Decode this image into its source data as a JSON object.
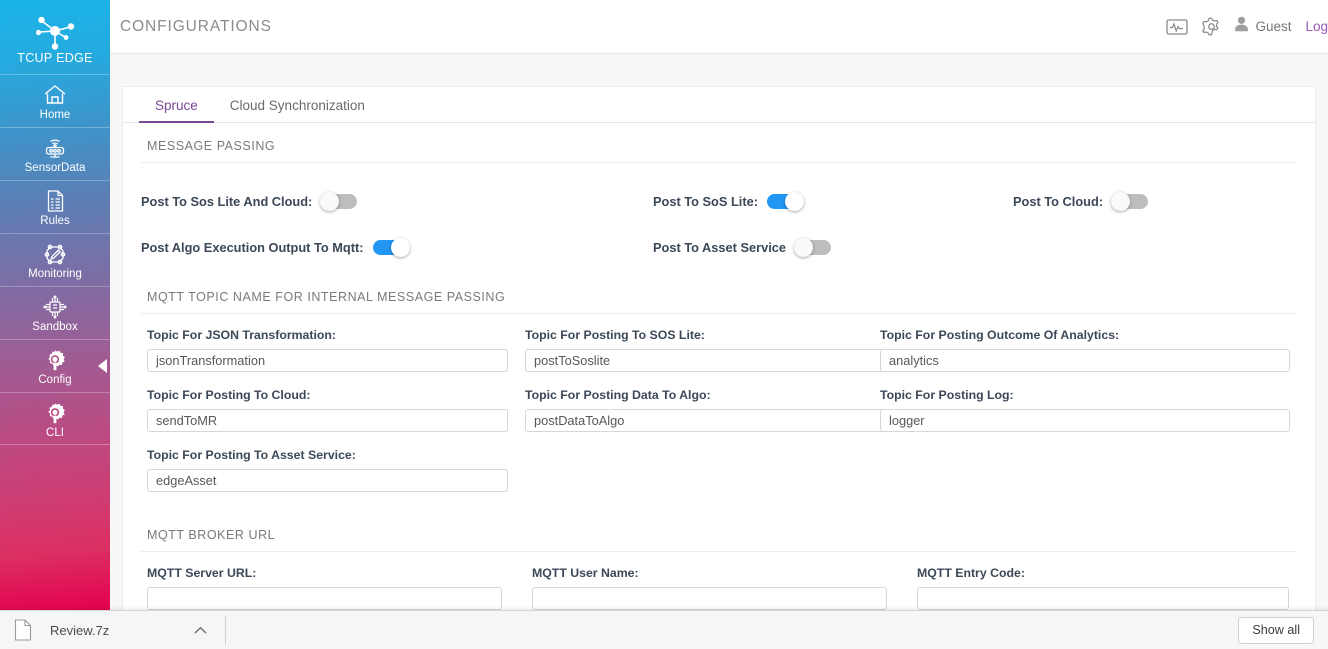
{
  "sidebar": {
    "logo": {
      "icon": "network-nodes-logo",
      "text": "TCUP EDGE"
    },
    "items": [
      {
        "label": "Home",
        "icon": "home-icon"
      },
      {
        "label": "SensorData",
        "icon": "sensor-icon"
      },
      {
        "label": "Rules",
        "icon": "document-rules-icon"
      },
      {
        "label": "Monitoring",
        "icon": "monitoring-icon"
      },
      {
        "label": "Sandbox",
        "icon": "chip-sandbox-icon"
      },
      {
        "label": "Config",
        "icon": "gear-wrench-icon",
        "active": true
      },
      {
        "label": "CLI",
        "icon": "gear-wrench-icon"
      }
    ]
  },
  "topbar": {
    "title": "CONFIGURATIONS",
    "monitor_icon": "pulse-monitor-icon",
    "settings_icon": "gear-icon",
    "user_icon": "user-avatar-icon",
    "username": "Guest",
    "logout_label": "Log",
    "accent_color": "#9b59b6"
  },
  "tabs": [
    {
      "label": "Spruce",
      "active": true
    },
    {
      "label": "Cloud Synchronization",
      "active": false
    }
  ],
  "sections": {
    "message_passing": {
      "title": "MESSAGE PASSING",
      "toggles": [
        {
          "label": "Post To Sos Lite And Cloud:",
          "on": false
        },
        {
          "label": "Post To SoS Lite:",
          "on": true
        },
        {
          "label": "Post To Cloud:",
          "on": false
        },
        {
          "label": "Post Algo Execution Output To Mqtt:",
          "on": true
        },
        {
          "label": "Post To Asset Service",
          "on": false
        }
      ]
    },
    "mqtt_topics": {
      "title": "MQTT TOPIC NAME FOR INTERNAL MESSAGE PASSING",
      "fields": [
        {
          "label": "Topic For JSON Transformation:",
          "value": "jsonTransformation"
        },
        {
          "label": "Topic For Posting To SOS Lite:",
          "value": "postToSoslite"
        },
        {
          "label": "Topic For Posting Outcome Of Analytics:",
          "value": "analytics"
        },
        {
          "label": "Topic For Posting To Cloud:",
          "value": "sendToMR"
        },
        {
          "label": "Topic For Posting Data To Algo:",
          "value": "postDataToAlgo"
        },
        {
          "label": "Topic For Posting Log:",
          "value": "logger"
        },
        {
          "label": "Topic For Posting To Asset Service:",
          "value": "edgeAsset"
        }
      ]
    },
    "mqtt_broker": {
      "title": "MQTT BROKER URL",
      "fields": [
        {
          "label": "MQTT Server URL:",
          "value": ""
        },
        {
          "label": "MQTT User Name:",
          "value": ""
        },
        {
          "label": "MQTT Entry Code:",
          "value": ""
        }
      ]
    }
  },
  "download_bar": {
    "file_icon": "file-icon",
    "file_name": "Review.7z",
    "chevron_icon": "chevron-up-icon",
    "show_all_label": "Show all"
  }
}
